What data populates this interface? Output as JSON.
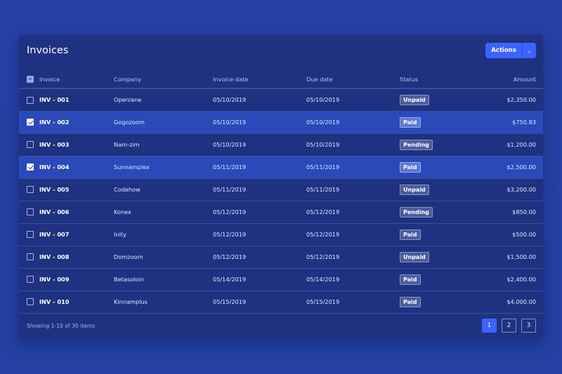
{
  "title": "Invoices",
  "actions": {
    "label": "Actions",
    "dropdown_icon": "chevron-down-icon"
  },
  "columns": [
    "Invoice",
    "Company",
    "Invoice date",
    "Due date",
    "Status",
    "Amount"
  ],
  "rows": [
    {
      "checked": false,
      "invoice": "INV - 001",
      "company": "Openlane",
      "invoice_date": "05/10/2019",
      "due_date": "05/10/2019",
      "status": "Unpaid",
      "amount": "$2,350.00"
    },
    {
      "checked": true,
      "invoice": "INV - 002",
      "company": "Gogozoom",
      "invoice_date": "05/10/2019",
      "due_date": "05/10/2019",
      "status": "Paid",
      "amount": "$750.83"
    },
    {
      "checked": false,
      "invoice": "INV - 003",
      "company": "Nam-zim",
      "invoice_date": "05/10/2019",
      "due_date": "05/10/2019",
      "status": "Pending",
      "amount": "$1,200.00"
    },
    {
      "checked": true,
      "invoice": "INV - 004",
      "company": "Sunnamplex",
      "invoice_date": "05/11/2019",
      "due_date": "05/11/2019",
      "status": "Paid",
      "amount": "$2,500.00"
    },
    {
      "checked": false,
      "invoice": "INV - 005",
      "company": "Codehow",
      "invoice_date": "05/11/2019",
      "due_date": "05/11/2019",
      "status": "Unpaid",
      "amount": "$3,200.00"
    },
    {
      "checked": false,
      "invoice": "INV - 006",
      "company": "Konex",
      "invoice_date": "05/12/2019",
      "due_date": "05/12/2019",
      "status": "Pending",
      "amount": "$850.00"
    },
    {
      "checked": false,
      "invoice": "INV - 007",
      "company": "Inity",
      "invoice_date": "05/12/2019",
      "due_date": "05/12/2019",
      "status": "Paid",
      "amount": "$500.00"
    },
    {
      "checked": false,
      "invoice": "INV - 008",
      "company": "Domzoom",
      "invoice_date": "05/12/2019",
      "due_date": "05/12/2019",
      "status": "Unpaid",
      "amount": "$1,500.00"
    },
    {
      "checked": false,
      "invoice": "INV - 009",
      "company": "Betasoloin",
      "invoice_date": "05/14/2019",
      "due_date": "05/14/2019",
      "status": "Paid",
      "amount": "$2,400.00"
    },
    {
      "checked": false,
      "invoice": "INV - 010",
      "company": "Kinnamplus",
      "invoice_date": "05/15/2019",
      "due_date": "05/15/2019",
      "status": "Paid",
      "amount": "$4,000.00"
    }
  ],
  "footer": {
    "summary": "Showing 1-10 of 30 items",
    "pages": [
      "1",
      "2",
      "3"
    ],
    "current_page": "1"
  }
}
